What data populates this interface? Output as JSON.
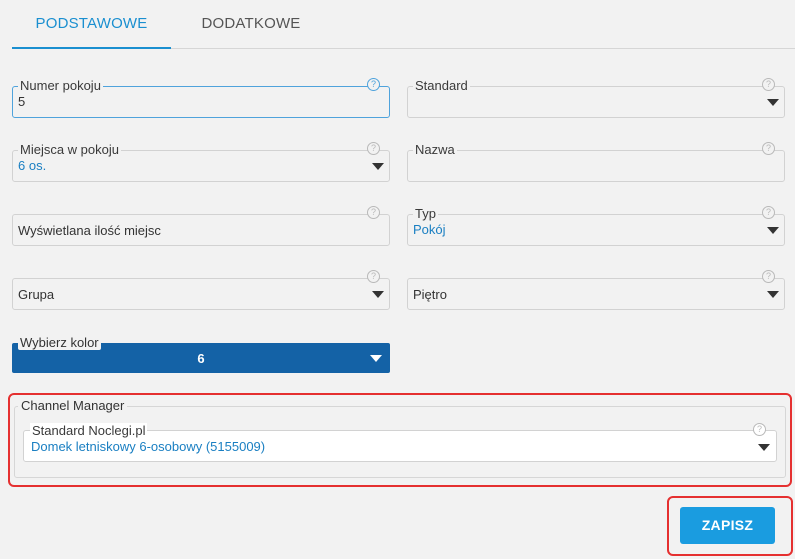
{
  "tabs": [
    {
      "label": "PODSTAWOWE",
      "active": true
    },
    {
      "label": "DODATKOWE",
      "active": false
    }
  ],
  "fields": {
    "room_number": {
      "label": "Numer pokoju",
      "value": "5"
    },
    "standard": {
      "label": "Standard",
      "value": ""
    },
    "places": {
      "label": "Miejsca w pokoju",
      "value": "6 os."
    },
    "name": {
      "label": "Nazwa",
      "value": ""
    },
    "displayed_places": {
      "label": "Wyświetlana ilość miejsc",
      "value": ""
    },
    "type": {
      "label": "Typ",
      "value": "Pokój"
    },
    "group": {
      "label": "Grupa",
      "value": ""
    },
    "floor": {
      "label": "Piętro",
      "value": ""
    },
    "color": {
      "label": "Wybierz kolor",
      "value": "6",
      "color": "#1462a6"
    }
  },
  "channel_manager": {
    "legend": "Channel Manager",
    "select_label": "Standard Noclegi.pl",
    "select_value": "Domek letniskowy 6-osobowy (5155009)"
  },
  "help_glyph": "?",
  "save_label": "ZAPISZ",
  "colors": {
    "accent": "#1a8fd0",
    "highlight": "#e53030",
    "button": "#1a9ce0"
  }
}
